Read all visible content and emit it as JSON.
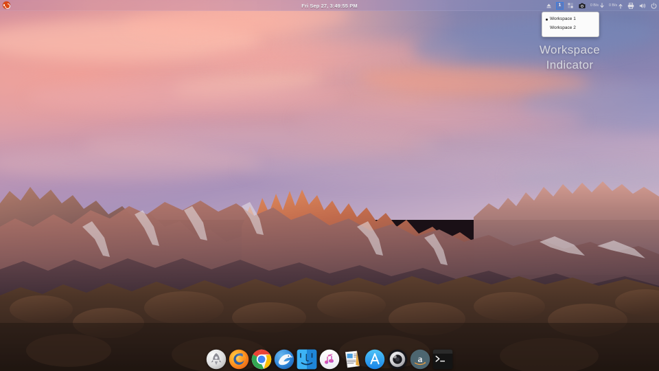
{
  "desktop": {
    "wallpaper_name": "macos-sierra-lone-pine-peak",
    "wallpaper_colors": {
      "sky_top_left": "#c98ba0",
      "sky_mid": "#d49ead",
      "sky_right": "#7e86b6",
      "cloud_highlight": "#ffb49a",
      "mountain_lit": "#c9704f",
      "mountain_shadow": "#4a3640",
      "foreground_rock": "#4a3326"
    }
  },
  "menubar": {
    "logo": {
      "name": "ubuntu-logo",
      "color": "#dd4814"
    },
    "clock": "Fri Sep 27,  3:49:55 PM",
    "workspace_button": {
      "label": "1",
      "accent": "#3b7de0"
    },
    "left_icons": [
      {
        "name": "eject-icon",
        "glyph": "eject"
      }
    ],
    "right_icons": [
      {
        "name": "app-grid-icon",
        "glyph": "grid"
      },
      {
        "name": "screenshot-camera-icon",
        "glyph": "camera"
      }
    ],
    "net_down": {
      "value": "0 B/s",
      "arrow": "down",
      "name": "network-download-rate"
    },
    "net_up": {
      "value": "0 B/s",
      "arrow": "up",
      "name": "network-upload-rate"
    },
    "tray_icons": [
      {
        "name": "printer-icon"
      },
      {
        "name": "volume-icon"
      },
      {
        "name": "power-icon"
      }
    ]
  },
  "workspace_menu": {
    "items": [
      {
        "label": "Workspace 1",
        "selected": true
      },
      {
        "label": "Workspace 2",
        "selected": false
      }
    ]
  },
  "annotation": {
    "line1": "Workspace",
    "line2": "Indicator",
    "color": "#d6d8e0"
  },
  "dock": {
    "items": [
      {
        "name": "launchpad",
        "label": "Launchpad"
      },
      {
        "name": "firefox",
        "label": "Firefox"
      },
      {
        "name": "chrome",
        "label": "Google Chrome"
      },
      {
        "name": "safari-bird",
        "label": "Browser"
      },
      {
        "name": "finder",
        "label": "Finder"
      },
      {
        "name": "music",
        "label": "Music"
      },
      {
        "name": "pages",
        "label": "Pages"
      },
      {
        "name": "app-store",
        "label": "App Store"
      },
      {
        "name": "system-disc",
        "label": "System"
      },
      {
        "name": "amazon",
        "label": "Amazon"
      },
      {
        "name": "terminal",
        "label": "Terminal"
      }
    ]
  }
}
